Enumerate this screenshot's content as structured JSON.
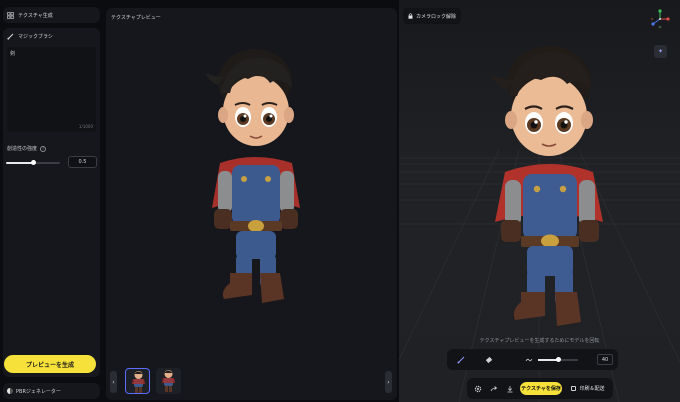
{
  "left_panel": {
    "texture_gen": {
      "title": "テクスチャ生成"
    },
    "magic_brush": {
      "title": "マジックブラシ",
      "prompt_value": "剣",
      "char_count": "1/1000",
      "creativity_label": "創造性の強度",
      "creativity_value": "0.5",
      "creativity_fraction": 0.5
    },
    "generate_preview_label": "プレビューを生成",
    "pbr_label": "PBRジェネレーター"
  },
  "middle_panel": {
    "title": "テクスチャプレビュー",
    "thumbnails": [
      {
        "name": "thumb-1",
        "active": true
      },
      {
        "name": "thumb-2",
        "active": false
      }
    ]
  },
  "viewport": {
    "camera_lock_label": "カメラロック解除",
    "hint_text": "テクスチャプレビューを生成するためにモデルを回転",
    "brush_size_value": "40",
    "brush_size_fraction": 0.5,
    "save_texture_label": "テクスチャを保存",
    "print_label": "印刷＆配送"
  },
  "colors": {
    "accent_yellow": "#f6e03a",
    "accent_blue": "#5b6cff",
    "panel": "#15171c",
    "background": "#0b0c0f"
  }
}
